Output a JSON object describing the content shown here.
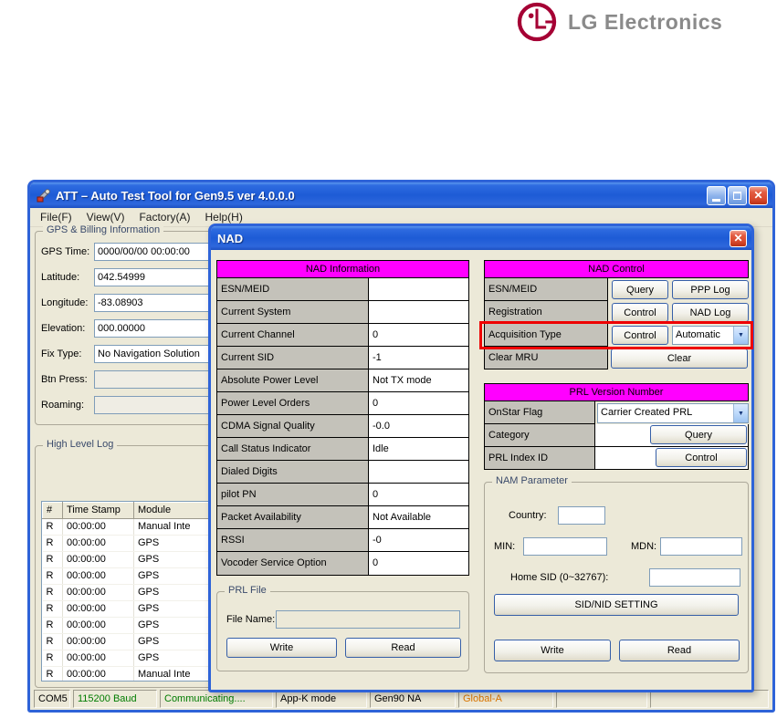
{
  "logo": {
    "text": "LG Electronics",
    "brand_color": "#A50034",
    "text_color": "#8A8A8A"
  },
  "app_window": {
    "title": "ATT – Auto Test Tool for Gen9.5 ver 4.0.0.0",
    "menu": [
      "File(F)",
      "View(V)",
      "Factory(A)",
      "Help(H)"
    ],
    "gps_group": {
      "title": "GPS & Billing Information",
      "fields": [
        {
          "label": "GPS Time:",
          "value": "0000/00/00 00:00:00"
        },
        {
          "label": "Latitude:",
          "value": "042.54999"
        },
        {
          "label": "Longitude:",
          "value": "-83.08903"
        },
        {
          "label": "Elevation:",
          "value": "000.00000"
        },
        {
          "label": "Fix Type:",
          "value": "No Navigation Solution"
        },
        {
          "label": "Btn Press:",
          "value": ""
        },
        {
          "label": "Roaming:",
          "value": ""
        }
      ]
    },
    "log_group": {
      "title": "High Level Log",
      "columns": [
        "#",
        "Time Stamp",
        "Module"
      ],
      "rows": [
        {
          "n": "R",
          "time": "00:00:00",
          "module": "Manual Inte"
        },
        {
          "n": "R",
          "time": "00:00:00",
          "module": "GPS"
        },
        {
          "n": "R",
          "time": "00:00:00",
          "module": "GPS"
        },
        {
          "n": "R",
          "time": "00:00:00",
          "module": "GPS"
        },
        {
          "n": "R",
          "time": "00:00:00",
          "module": "GPS"
        },
        {
          "n": "R",
          "time": "00:00:00",
          "module": "GPS"
        },
        {
          "n": "R",
          "time": "00:00:00",
          "module": "GPS"
        },
        {
          "n": "R",
          "time": "00:00:00",
          "module": "GPS"
        },
        {
          "n": "R",
          "time": "00:00:00",
          "module": "GPS"
        },
        {
          "n": "R",
          "time": "00:00:00",
          "module": "Manual Inte"
        }
      ]
    },
    "statusbar": [
      "COM5",
      "115200 Baud",
      "Communicating....",
      "App-K mode",
      "Gen90 NA",
      "Global-A"
    ],
    "status_colors": {
      "baud": "#007C00",
      "communicating": "#007C00",
      "global_a": "#DD7700"
    }
  },
  "nad_dialog": {
    "title": "NAD",
    "info": {
      "header": "NAD Information",
      "rows": [
        {
          "label": "ESN/MEID",
          "value": ""
        },
        {
          "label": "Current System",
          "value": ""
        },
        {
          "label": "Current Channel",
          "value": "0"
        },
        {
          "label": "Current SID",
          "value": "-1"
        },
        {
          "label": "Absolute Power Level",
          "value": "Not TX mode"
        },
        {
          "label": "Power Level Orders",
          "value": "0"
        },
        {
          "label": "CDMA Signal Quality",
          "value": "-0.0"
        },
        {
          "label": "Call Status Indicator",
          "value": "Idle"
        },
        {
          "label": "Dialed Digits",
          "value": ""
        },
        {
          "label": "pilot PN",
          "value": "0"
        },
        {
          "label": "Packet Availability",
          "value": "Not Available"
        },
        {
          "label": "RSSI",
          "value": "-0"
        },
        {
          "label": "Vocoder Service Option",
          "value": "0"
        }
      ]
    },
    "control": {
      "header": "NAD Control",
      "esn_label": "ESN/MEID",
      "esn_btn1": "Query",
      "esn_btn2": "PPP Log",
      "reg_label": "Registration",
      "reg_btn1": "Control",
      "reg_btn2": "NAD Log",
      "acq_label": "Acquisition Type",
      "acq_btn": "Control",
      "acq_combo": "Automatic",
      "mru_label": "Clear MRU",
      "mru_btn": "Clear"
    },
    "prl_version": {
      "header": "PRL Version Number",
      "onstar_label": "OnStar Flag",
      "onstar_combo": "Carrier Created PRL",
      "category_label": "Category",
      "category_btn": "Query",
      "index_label": "PRL Index ID",
      "index_btn": "Control"
    },
    "nam": {
      "title": "NAM Parameter",
      "country_label": "Country:",
      "min_label": "MIN:",
      "mdn_label": "MDN:",
      "home_sid_label": "Home SID (0~32767):",
      "sid_nid_btn": "SID/NID SETTING",
      "write_btn": "Write",
      "read_btn": "Read"
    },
    "prl_file": {
      "title": "PRL File",
      "file_label": "File Name:",
      "file_value": "",
      "write_btn": "Write",
      "read_btn": "Read"
    },
    "highlight_color": "#EE0000",
    "header_color": "#FF00FF"
  }
}
